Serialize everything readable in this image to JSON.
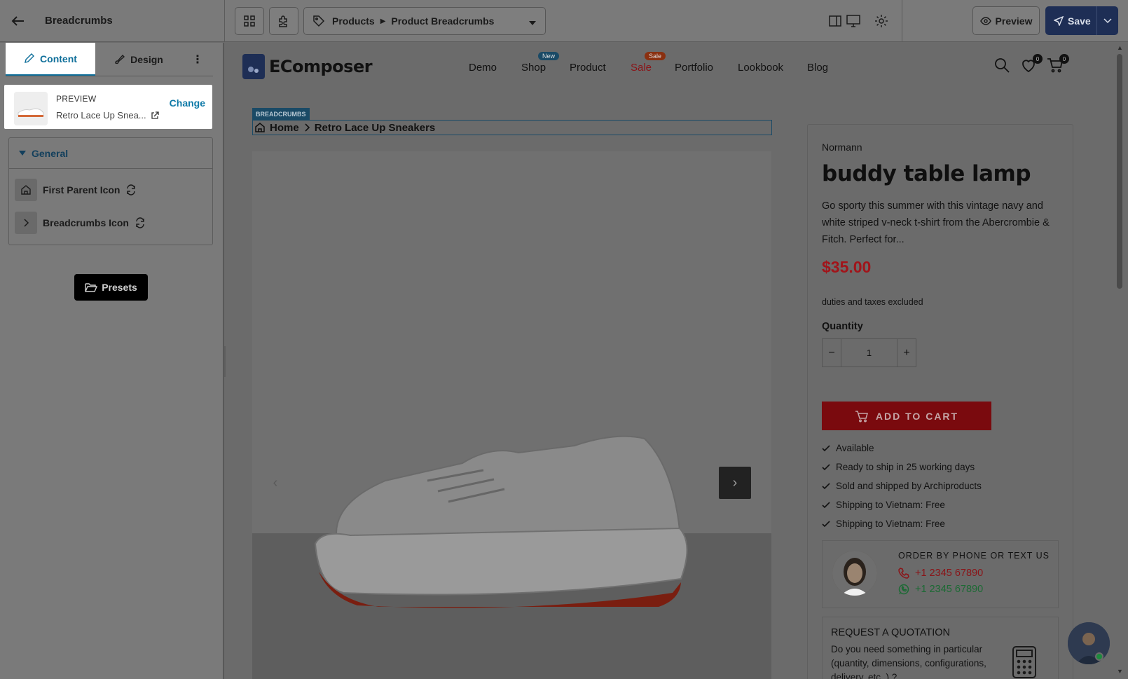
{
  "topbar": {
    "title": "Breadcrumbs",
    "selector": {
      "parent": "Products",
      "current": "Product Breadcrumbs"
    },
    "preview_label": "Preview",
    "save_label": "Save"
  },
  "sidebar": {
    "tabs": [
      {
        "label": "Content",
        "active": true
      },
      {
        "label": "Design",
        "active": false
      }
    ],
    "preview_card": {
      "label": "PREVIEW",
      "product_name": "Retro Lace Up Snea...",
      "change_label": "Change"
    },
    "general": {
      "heading": "General",
      "items": [
        {
          "label": "First Parent Icon",
          "icon": "home-icon"
        },
        {
          "label": "Breadcrumbs Icon",
          "icon": "chevron-right-icon"
        }
      ]
    },
    "presets_label": "Presets"
  },
  "site": {
    "logo_text": "EComposer",
    "nav": [
      {
        "label": "Demo"
      },
      {
        "label": "Shop",
        "badge": "New"
      },
      {
        "label": "Product"
      },
      {
        "label": "Sale",
        "badge": "Sale"
      },
      {
        "label": "Portfolio"
      },
      {
        "label": "Lookbook"
      },
      {
        "label": "Blog"
      }
    ],
    "wishlist_count": "0",
    "cart_count": "0"
  },
  "breadcrumbs": {
    "tag": "BREADCRUMBS",
    "home": "Home",
    "current": "Retro Lace Up Sneakers"
  },
  "product": {
    "vendor": "Normann",
    "title": "buddy table lamp",
    "description": "Go sporty this summer with this vintage navy and white striped v-neck t-shirt from the Abercrombie & Fitch. Perfect for...",
    "price": "$35.00",
    "tax_note": "duties and taxes excluded",
    "quantity_label": "Quantity",
    "quantity": "1",
    "add_to_cart": "ADD TO CART",
    "features": [
      "Available",
      "Ready to ship in 25 working days",
      "Sold and shipped by Archiproducts",
      "Shipping to Vietnam: Free",
      "Shipping to Vietnam: Free"
    ],
    "order_box": {
      "title": "ORDER BY PHONE OR TEXT US",
      "phone": "+1 2345 67890",
      "whatsapp": "+1 2345 67890"
    },
    "quote_box": {
      "title": "REQUEST A QUOTATION",
      "text": "Do you need something in particular (quantity, dimensions, configurations, delivery, etc. ) ?"
    }
  },
  "colors": {
    "accent": "#0f7aa8",
    "price": "#a1141a",
    "cart_button": "#7a0a0e",
    "save_button": "#1e2e55",
    "whatsapp": "#1c7a3c"
  }
}
